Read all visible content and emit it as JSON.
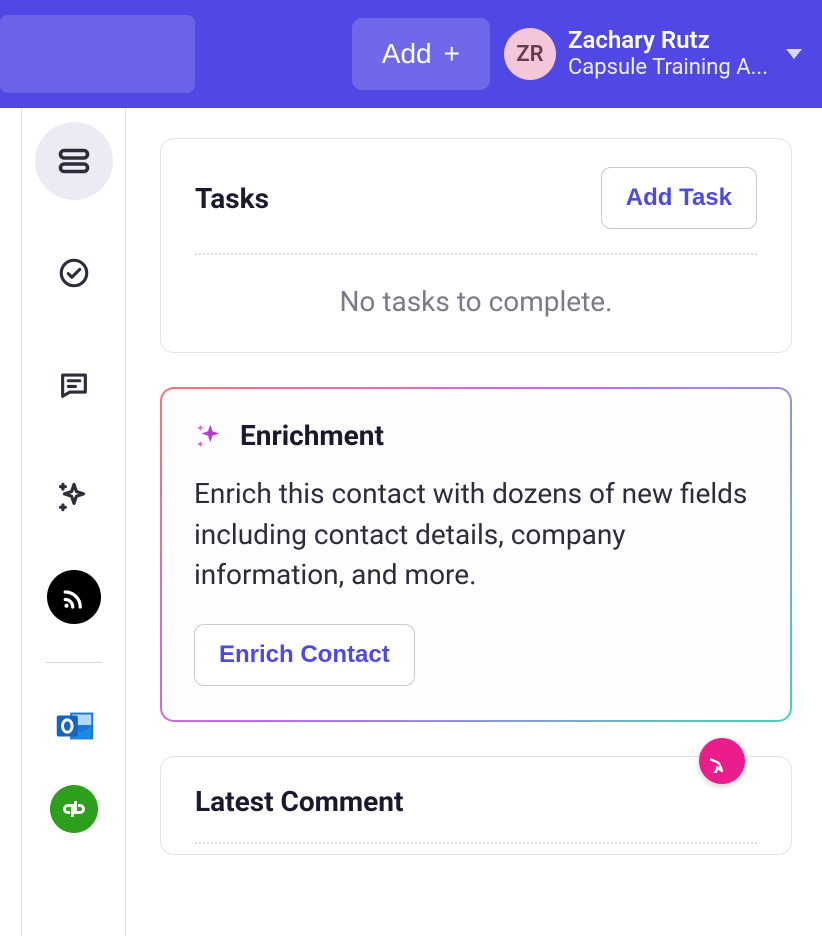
{
  "header": {
    "add_label": "Add",
    "user": {
      "initials": "ZR",
      "name": "Zachary Rutz",
      "subtitle": "Capsule Training A..."
    }
  },
  "tasks": {
    "title": "Tasks",
    "add_label": "Add Task",
    "empty": "No tasks to complete."
  },
  "enrichment": {
    "title": "Enrichment",
    "body": "Enrich this contact with dozens of new fields including contact details, company information, and more.",
    "button": "Enrich Contact"
  },
  "comment": {
    "title": "Latest Comment"
  },
  "rail_icons": [
    "list-icon",
    "check-circle-icon",
    "message-icon",
    "sparkle-icon",
    "rss-dark-icon",
    "outlook-icon",
    "quickbooks-icon"
  ]
}
